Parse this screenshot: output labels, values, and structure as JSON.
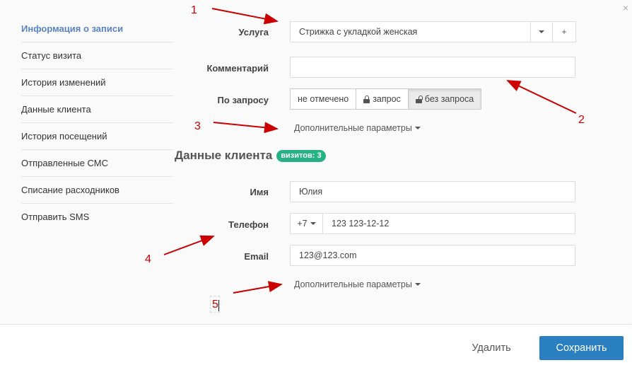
{
  "close_icon": "×",
  "sidebar": {
    "items": [
      {
        "label": "Информация о записи",
        "active": true
      },
      {
        "label": "Статус визита"
      },
      {
        "label": "История изменений"
      },
      {
        "label": "Данные клиента"
      },
      {
        "label": "История посещений"
      },
      {
        "label": "Отправленные СМС"
      },
      {
        "label": "Списание расходников"
      },
      {
        "label": "Отправить SMS"
      }
    ]
  },
  "visit": {
    "service_label": "Услуга",
    "service_value": "Стрижка с укладкой женская",
    "add_symbol": "+",
    "comment_label": "Комментарий",
    "comment_value": "",
    "request_label": "По запросу",
    "request_options": [
      {
        "label": "не отмечено",
        "icon": ""
      },
      {
        "label": "запрос",
        "icon": "lock-icon"
      },
      {
        "label": "без запроса",
        "icon": "unlock-icon",
        "selected": true
      }
    ],
    "more_params": "Дополнительные параметры"
  },
  "client": {
    "title": "Данные клиента",
    "visits_badge": "визитов: 3",
    "name_label": "Имя",
    "name_value": "Юлия",
    "phone_label": "Телефон",
    "phone_code": "+7",
    "phone_value": "123 123-12-12",
    "email_label": "Email",
    "email_value": "123@123.com",
    "more_params": "Дополнительные параметры"
  },
  "footer": {
    "delete_label": "Удалить",
    "save_label": "Сохранить"
  },
  "annotations": {
    "n1": "1",
    "n2": "2",
    "n3": "3",
    "n4": "4",
    "n5": "5",
    "color": "#cc0000"
  },
  "colors": {
    "accent": "#2a7fc1",
    "sidebar_active": "#5a84c1",
    "badge": "#26b383"
  }
}
